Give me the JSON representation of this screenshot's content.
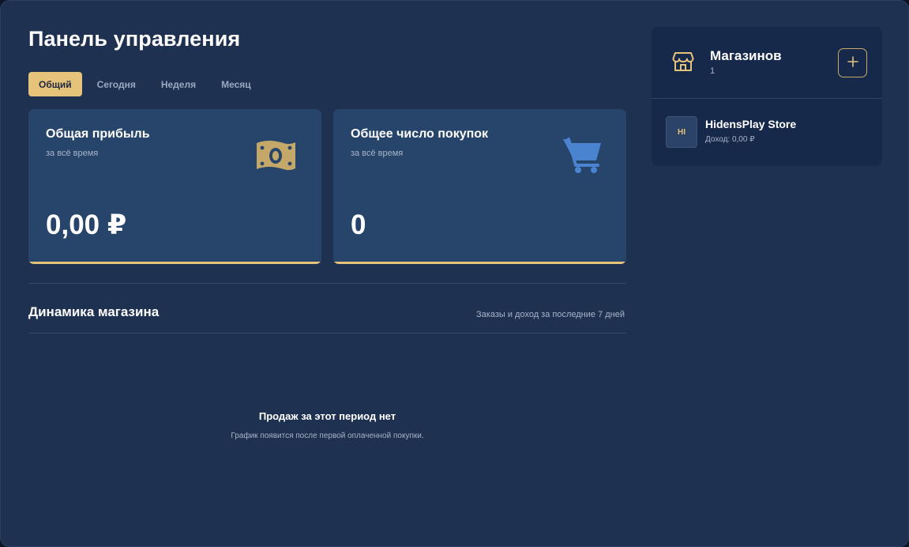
{
  "header": {
    "title": "Панель управления"
  },
  "tabs": [
    {
      "label": "Общий",
      "active": true
    },
    {
      "label": "Сегодня",
      "active": false
    },
    {
      "label": "Неделя",
      "active": false
    },
    {
      "label": "Месяц",
      "active": false
    }
  ],
  "cards": [
    {
      "title": "Общая прибыль",
      "subtitle": "за всё время",
      "value": "0,00 ₽",
      "icon": "money-icon",
      "icon_color": "#c4a86a"
    },
    {
      "title": "Общее число покупок",
      "subtitle": "за всё время",
      "value": "0",
      "icon": "cart-icon",
      "icon_color": "#4a83d0"
    }
  ],
  "dynamics": {
    "title": "Динамика магазина",
    "subtitle": "Заказы и доход за последние 7 дней",
    "empty_title": "Продаж за этот период нет",
    "empty_subtitle": "График появится после первой оплаченной покупки."
  },
  "stores": {
    "title": "Магазинов",
    "count": "1",
    "icon": "store-icon",
    "add_icon": "plus-icon",
    "items": [
      {
        "initials": "HI",
        "name": "HidensPlay Store",
        "income": "Доход: 0,00 ₽"
      }
    ]
  },
  "colors": {
    "background": "#1e3150",
    "card": "#27456a",
    "panel": "#17294a",
    "accent": "#e5c37a",
    "cart": "#4a83d0"
  }
}
